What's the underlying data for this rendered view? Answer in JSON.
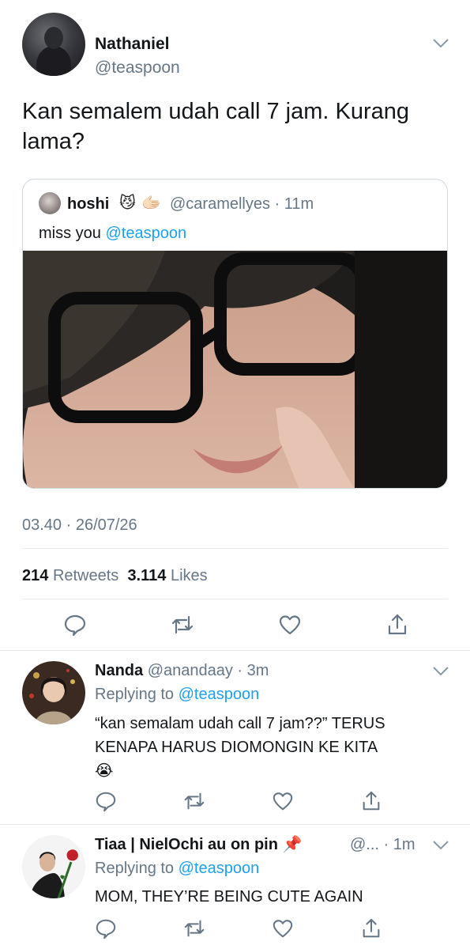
{
  "main_tweet": {
    "name": "Nathaniel",
    "handle": "@teaspoon",
    "text": "Kan semalem udah call 7 jam. Kurang lama?",
    "timestamp": "03.40 · 26/07/26",
    "retweets_count": "214",
    "retweets_label": "Retweets",
    "likes_count": "3.114",
    "likes_label": "Likes"
  },
  "quoted_tweet": {
    "name": "hoshi",
    "emoji_1": "😼",
    "emoji_2": "🫱🏻",
    "handle_time": "@caramellyes · 11m",
    "text_prefix": "miss you ",
    "mention": "@teaspoon"
  },
  "replies": [
    {
      "name": "Nanda",
      "handle_time": "@anandaay · 3m",
      "replying_prefix": "Replying to ",
      "replying_to": "@teaspoon",
      "text": "“kan semalam udah call 7 jam??” TERUS KENAPA HARUS DIOMONGIN KE KITA",
      "emoji": "😭"
    },
    {
      "name": "Tiaa | NielOchi au on pin",
      "emoji": "📌",
      "handle": "@...",
      "time": "· 1m",
      "replying_prefix": "Replying to ",
      "replying_to": "@teaspoon",
      "text": "MOM, THEY’RE BEING CUTE AGAIN"
    }
  ],
  "icons": [
    "reply-icon",
    "retweet-icon",
    "like-icon",
    "share-icon",
    "chevron-down-icon"
  ],
  "colors": {
    "link": "#1da1f2",
    "muted": "#657786",
    "text": "#14171a",
    "divider": "#e6ecf0"
  }
}
